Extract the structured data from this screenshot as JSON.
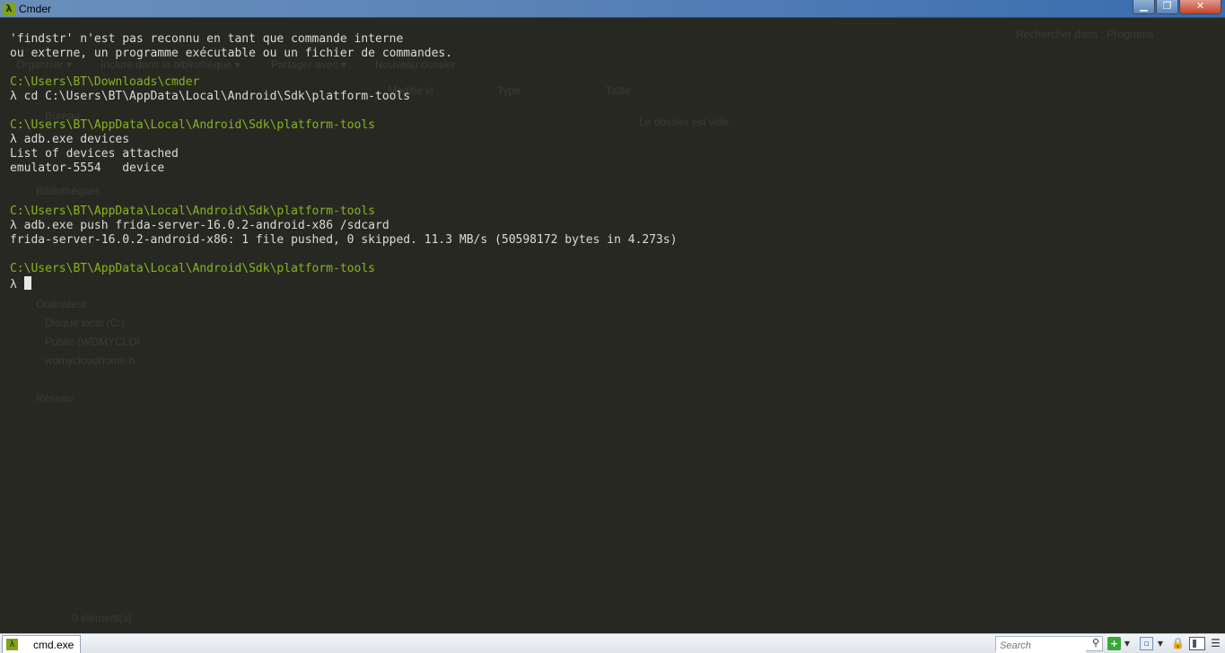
{
  "window": {
    "title": "Cmder",
    "app_icon": "λ",
    "minimize": "▁",
    "maximize": "❐",
    "close": "✕"
  },
  "background_explorer": {
    "organize": "Organiser ▾",
    "include_library": "Inclure dans la bibliothèque ▾",
    "share": "Partager avec ▾",
    "new_folder": "Nouveau dossier",
    "search_placeholder": "Rechercher dans : Programs",
    "col_modified": "Modifié le",
    "col_type": "Type",
    "col_size": "Taille",
    "empty_message": "Le dossier est vide.",
    "office": "Bureau",
    "libraries": "Bibliothèques",
    "computer": "Ordinateur",
    "local_disk": "Disque local (C:)",
    "public": "Public (WDMYCLOI",
    "wdmycloud": "wdmycloudhome.h",
    "network": "Réseau",
    "items": "0 élément(s)"
  },
  "terminal": {
    "lines": [
      {
        "kind": "out",
        "text": "'findstr' n'est pas reconnu en tant que commande interne"
      },
      {
        "kind": "out",
        "text": "ou externe, un programme exécutable ou un fichier de commandes."
      },
      {
        "kind": "blank",
        "text": ""
      },
      {
        "kind": "path",
        "text": "C:\\Users\\BT\\Downloads\\cmder"
      },
      {
        "kind": "cmd",
        "text": "λ cd C:\\Users\\BT\\AppData\\Local\\Android\\Sdk\\platform-tools"
      },
      {
        "kind": "blank",
        "text": ""
      },
      {
        "kind": "path",
        "text": "C:\\Users\\BT\\AppData\\Local\\Android\\Sdk\\platform-tools"
      },
      {
        "kind": "cmd",
        "text": "λ adb.exe devices"
      },
      {
        "kind": "out",
        "text": "List of devices attached"
      },
      {
        "kind": "out",
        "text": "emulator-5554   device"
      },
      {
        "kind": "blank",
        "text": ""
      },
      {
        "kind": "blank",
        "text": ""
      },
      {
        "kind": "path",
        "text": "C:\\Users\\BT\\AppData\\Local\\Android\\Sdk\\platform-tools"
      },
      {
        "kind": "cmd",
        "text": "λ adb.exe push frida-server-16.0.2-android-x86 /sdcard"
      },
      {
        "kind": "out",
        "text": "frida-server-16.0.2-android-x86: 1 file pushed, 0 skipped. 11.3 MB/s (50598172 bytes in 4.273s)"
      },
      {
        "kind": "blank",
        "text": ""
      },
      {
        "kind": "path",
        "text": "C:\\Users\\BT\\AppData\\Local\\Android\\Sdk\\platform-tools"
      }
    ],
    "prompt": "λ ",
    "colors": {
      "path": "#8ab31f",
      "text": "#dcdcd4",
      "background": "#272822"
    }
  },
  "statusbar": {
    "tab_label": "cmd.exe",
    "tab_icon": "λ",
    "search_placeholder": "Search",
    "search_icon": "⚲",
    "new_console_icon": "+",
    "dropdown": "▼",
    "view_icon": "▫",
    "lock_icon": "🔒",
    "menu_icon": "☰"
  }
}
